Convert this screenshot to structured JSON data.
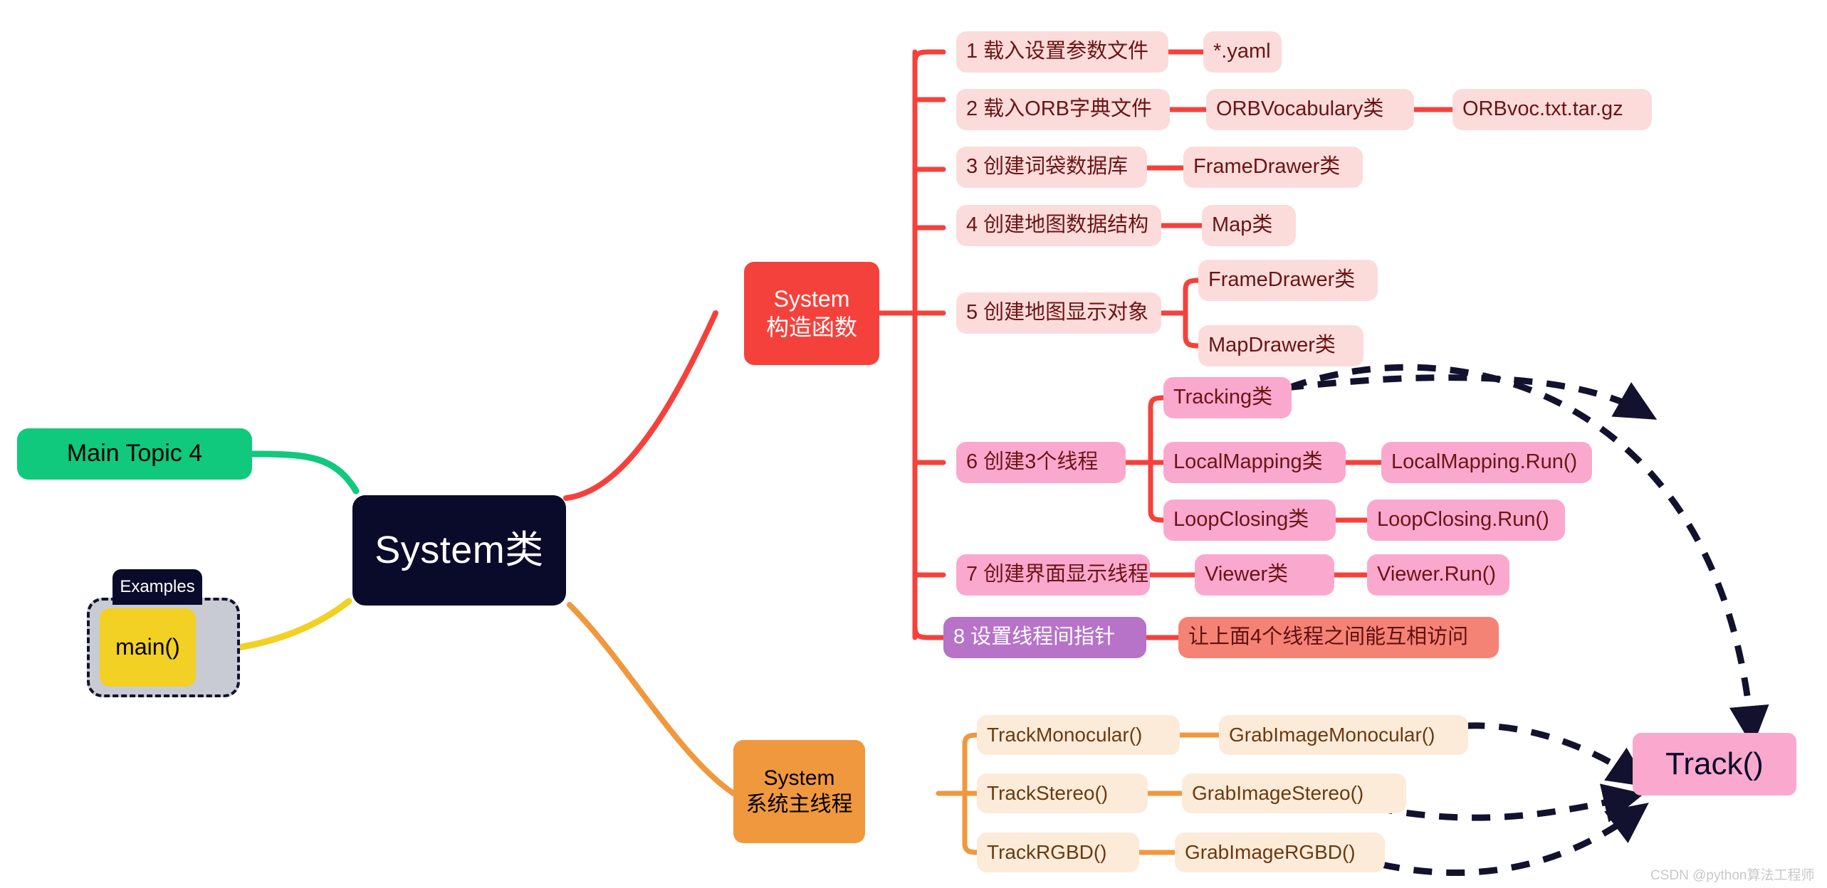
{
  "diagram": {
    "type": "mindmap",
    "title": "System类",
    "watermark": "CSDN @python算法工程师",
    "colors": {
      "root": "#0A0A2B",
      "green_branch": "#10C97D",
      "yellow_branch": "#F2D024",
      "red_branch": "#F5413B",
      "orange_branch": "#F0983E",
      "pink_light": "#FBDCDB",
      "pink_mid": "#FBA8CE",
      "purple": "#B673C8",
      "salmon": "#F58375",
      "cream": "#FCEBD9",
      "dashed_arrow": "#12122F",
      "watermark": "#C8C8C8"
    }
  },
  "root": {
    "label": "System类"
  },
  "left": {
    "main_topic": {
      "label": "Main Topic 4"
    },
    "examples_tab": {
      "label": "Examples"
    },
    "main_fn": {
      "label": "main()"
    }
  },
  "constructor_branch": {
    "title_line1": "System",
    "title_line2": "构造函数",
    "steps": [
      {
        "label": "1 载入设置参数文件",
        "children": [
          {
            "label": "*.yaml"
          }
        ]
      },
      {
        "label": "2 载入ORB字典文件",
        "children": [
          {
            "label": "ORBVocabulary类",
            "children": [
              {
                "label": "ORBvoc.txt.tar.gz"
              }
            ]
          }
        ]
      },
      {
        "label": "3 创建词袋数据库",
        "children": [
          {
            "label": "FrameDrawer类"
          }
        ]
      },
      {
        "label": "4 创建地图数据结构",
        "children": [
          {
            "label": "Map类"
          }
        ]
      },
      {
        "label": "5 创建地图显示对象",
        "children": [
          {
            "label": "FrameDrawer类"
          },
          {
            "label": "MapDrawer类"
          }
        ]
      },
      {
        "label": "6 创建3个线程",
        "children": [
          {
            "label": "Tracking类"
          },
          {
            "label": "LocalMapping类",
            "children": [
              {
                "label": "LocalMapping.Run()"
              }
            ]
          },
          {
            "label": "LoopClosing类",
            "children": [
              {
                "label": "LoopClosing.Run()"
              }
            ]
          }
        ]
      },
      {
        "label": "7 创建界面显示线程",
        "children": [
          {
            "label": "Viewer类",
            "children": [
              {
                "label": "Viewer.Run()"
              }
            ]
          }
        ]
      },
      {
        "label": "8 设置线程间指针",
        "children": [
          {
            "label": "让上面4个线程之间能互相访问"
          }
        ]
      }
    ]
  },
  "main_thread_branch": {
    "title_line1": "System",
    "title_line2": "系统主线程",
    "rows": [
      {
        "label": "TrackMonocular()",
        "child": "GrabImageMonocular()"
      },
      {
        "label": "TrackStereo()",
        "child": "GrabImageStereo()"
      },
      {
        "label": "TrackRGBD()",
        "child": "GrabImageRGBD()"
      }
    ]
  },
  "track_node": {
    "label": "Track()"
  }
}
